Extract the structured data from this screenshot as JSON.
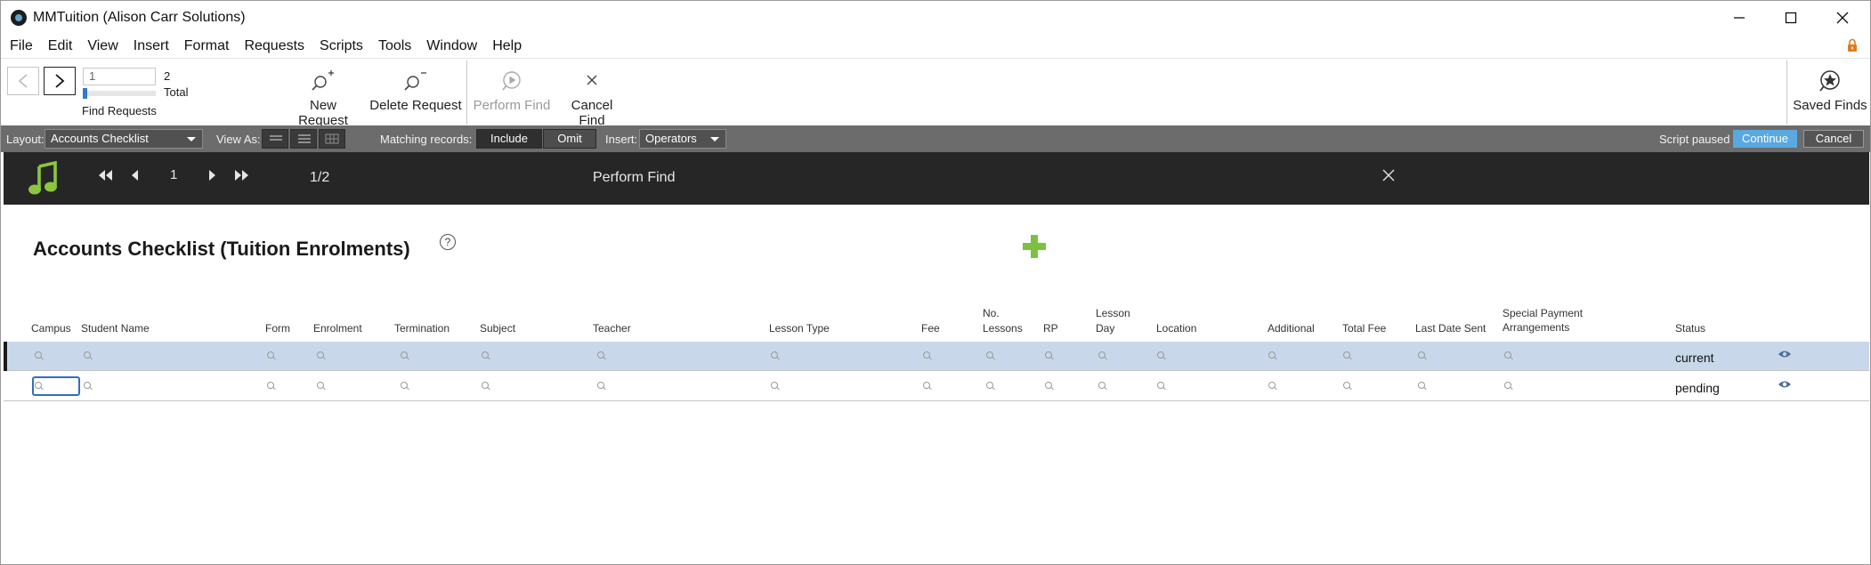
{
  "window": {
    "title": "MMTuition (Alison Carr Solutions)",
    "controls": {
      "minimize": "—",
      "maximize": "☐",
      "close": "✕"
    }
  },
  "menu": [
    "File",
    "Edit",
    "View",
    "Insert",
    "Format",
    "Requests",
    "Scripts",
    "Tools",
    "Window",
    "Help"
  ],
  "toolbar": {
    "record_input": "1",
    "total_count": "2",
    "total_label": "Total",
    "find_requests_label": "Find Requests",
    "new_request": "New Request",
    "delete_request": "Delete Request",
    "perform_find": "Perform Find",
    "cancel_find": "Cancel Find",
    "saved_finds": "Saved Finds"
  },
  "layoutbar": {
    "layout_label": "Layout:",
    "layout_value": "Accounts Checklist",
    "view_as_label": "View As:",
    "matching_label": "Matching records:",
    "include": "Include",
    "omit": "Omit",
    "insert_label": "Insert:",
    "insert_value": "Operators",
    "script_paused": "Script paused",
    "continue": "Continue",
    "cancel": "Cancel"
  },
  "scriptbar": {
    "record_number": "1",
    "count": "1/2",
    "title": "Perform Find",
    "close": "✕"
  },
  "page": {
    "title": "Accounts Checklist (Tuition Enrolments)",
    "help": "?",
    "columns": {
      "campus": "Campus",
      "student_name": "Student Name",
      "form": "Form",
      "enrolment": "Enrolment",
      "termination": "Termination",
      "subject": "Subject",
      "teacher": "Teacher",
      "lesson_type": "Lesson Type",
      "fee": "Fee",
      "no_lessons_1": "No.",
      "no_lessons_2": "Lessons",
      "rp": "RP",
      "lesson_day_1": "Lesson",
      "lesson_day_2": "Day",
      "location": "Location",
      "additional": "Additional",
      "total_fee": "Total Fee",
      "last_date_sent": "Last Date Sent",
      "special_1": "Special Payment",
      "special_2": "Arrangements",
      "status": "Status"
    },
    "rows": [
      {
        "status": "current"
      },
      {
        "status": "pending"
      }
    ]
  },
  "colors": {
    "accent": "#5aa8e0",
    "selected_row": "#c8d8ea",
    "add_icon": "#7cc142",
    "music_icon": "#8dc63f"
  }
}
